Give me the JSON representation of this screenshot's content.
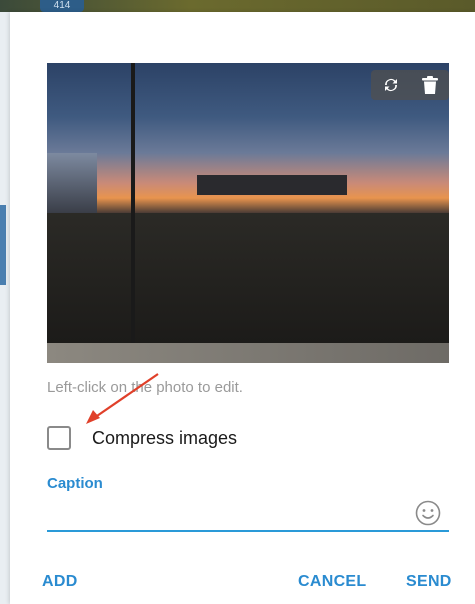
{
  "background": {
    "badge_text": "414"
  },
  "photo": {
    "toolbar": {
      "replace_icon": "refresh-icon",
      "delete_icon": "trash-icon"
    }
  },
  "hint_text": "Left-click on the photo to edit.",
  "compress": {
    "label": "Compress images",
    "checked": false
  },
  "caption": {
    "label": "Caption",
    "value": "",
    "emoji_icon": "smiley-icon"
  },
  "actions": {
    "add_label": "ADD",
    "cancel_label": "CANCEL",
    "send_label": "SEND"
  },
  "colors": {
    "accent": "#2a8bd0",
    "hint": "#9a9a9a",
    "annotation_arrow": "#e0402a"
  }
}
